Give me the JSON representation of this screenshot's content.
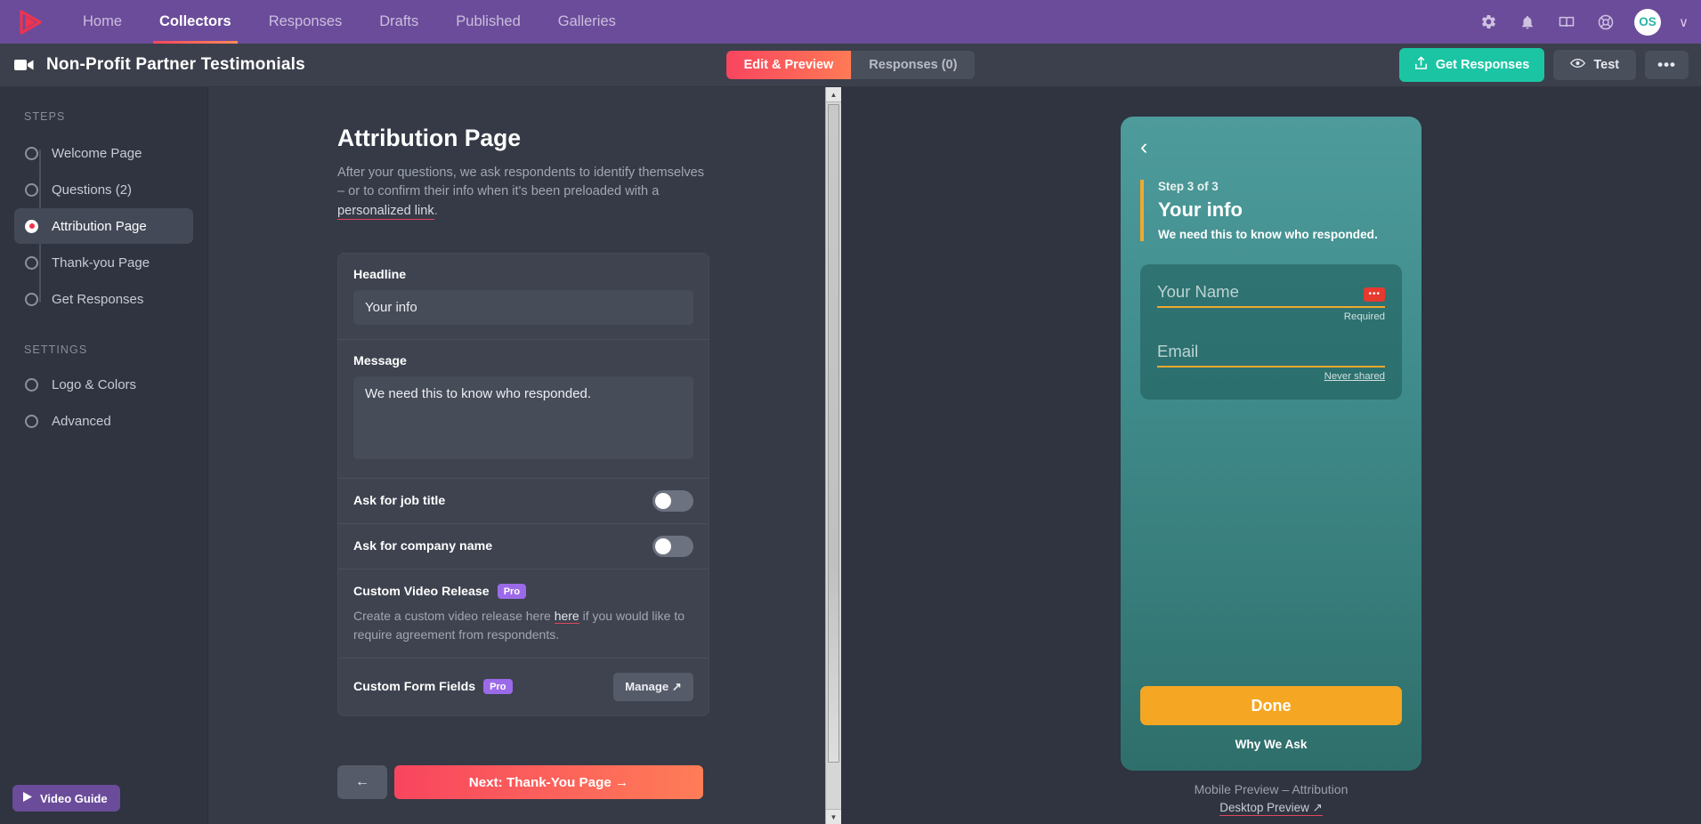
{
  "topnav": {
    "logo": "play-logo",
    "items": [
      {
        "label": "Home",
        "active": false
      },
      {
        "label": "Collectors",
        "active": true
      },
      {
        "label": "Responses",
        "active": false
      },
      {
        "label": "Drafts",
        "active": false
      },
      {
        "label": "Published",
        "active": false
      },
      {
        "label": "Galleries",
        "active": false
      }
    ],
    "icons": [
      "gear-icon",
      "bell-icon",
      "book-icon",
      "lifebuoy-icon"
    ],
    "avatar_initials": "OS",
    "avatar_color": "#27b5a0",
    "chevron": "∨",
    "background": "#6b4c9a"
  },
  "subheader": {
    "doc_icon": "video-camera-icon",
    "title": "Non-Profit Partner Testimonials",
    "tabs": [
      {
        "label": "Edit & Preview",
        "active": true
      },
      {
        "label": "Responses (0)",
        "active": false
      }
    ],
    "get_responses_label": "Get Responses",
    "get_responses_color": "#1bc5a3",
    "test_label": "Test",
    "more_label": "•••"
  },
  "sidebar": {
    "steps_label": "STEPS",
    "steps": [
      {
        "label": "Welcome Page",
        "active": false
      },
      {
        "label": "Questions (2)",
        "active": false
      },
      {
        "label": "Attribution Page",
        "active": true
      },
      {
        "label": "Thank-you Page",
        "active": false
      },
      {
        "label": "Get Responses",
        "active": false
      }
    ],
    "settings_label": "SETTINGS",
    "settings": [
      {
        "label": "Logo & Colors",
        "active": false
      },
      {
        "label": "Advanced",
        "active": false
      }
    ],
    "video_guide_label": "Video Guide"
  },
  "editor": {
    "title": "Attribution Page",
    "description_part1": "After your questions, we ask respondents to identify themselves – or to confirm their info when it's been preloaded with a ",
    "description_link": "personalized link",
    "description_part2": ".",
    "headline_label": "Headline",
    "headline_value": "Your info",
    "message_label": "Message",
    "message_value": "We need this to know who responded.",
    "job_title_label": "Ask for job title",
    "job_title_on": false,
    "company_name_label": "Ask for company name",
    "company_name_on": false,
    "video_release_label": "Custom Video Release",
    "video_release_badge": "Pro",
    "video_release_help_a": "Create a custom video release here ",
    "video_release_help_link": "here",
    "video_release_help_b": " if you would like to require agreement from respondents.",
    "form_fields_label": "Custom Form Fields",
    "form_fields_badge": "Pro",
    "manage_label": "Manage ↗",
    "back_label": "←",
    "next_label": "Next: Thank-You Page →",
    "pro_badge_color": "#9b6ae8"
  },
  "preview": {
    "arrow_left": "‹",
    "arrow_right": "›",
    "back_chevron": "‹",
    "step_of": "Step 3 of 3",
    "title": "Your info",
    "message": "We need this to know who responded.",
    "accent_color": "#f0a92e",
    "fields": [
      {
        "placeholder": "Your Name",
        "hint": "Required",
        "hint_underline": false,
        "chip": "•••",
        "chip_color": "#e8392f"
      },
      {
        "placeholder": "Email",
        "hint": "Never shared",
        "hint_underline": true,
        "chip": null
      }
    ],
    "done_label": "Done",
    "done_color": "#f5a623",
    "why_we_ask_label": "Why We Ask",
    "caption": "Mobile Preview – Attribution",
    "desktop_link": "Desktop Preview ↗"
  }
}
